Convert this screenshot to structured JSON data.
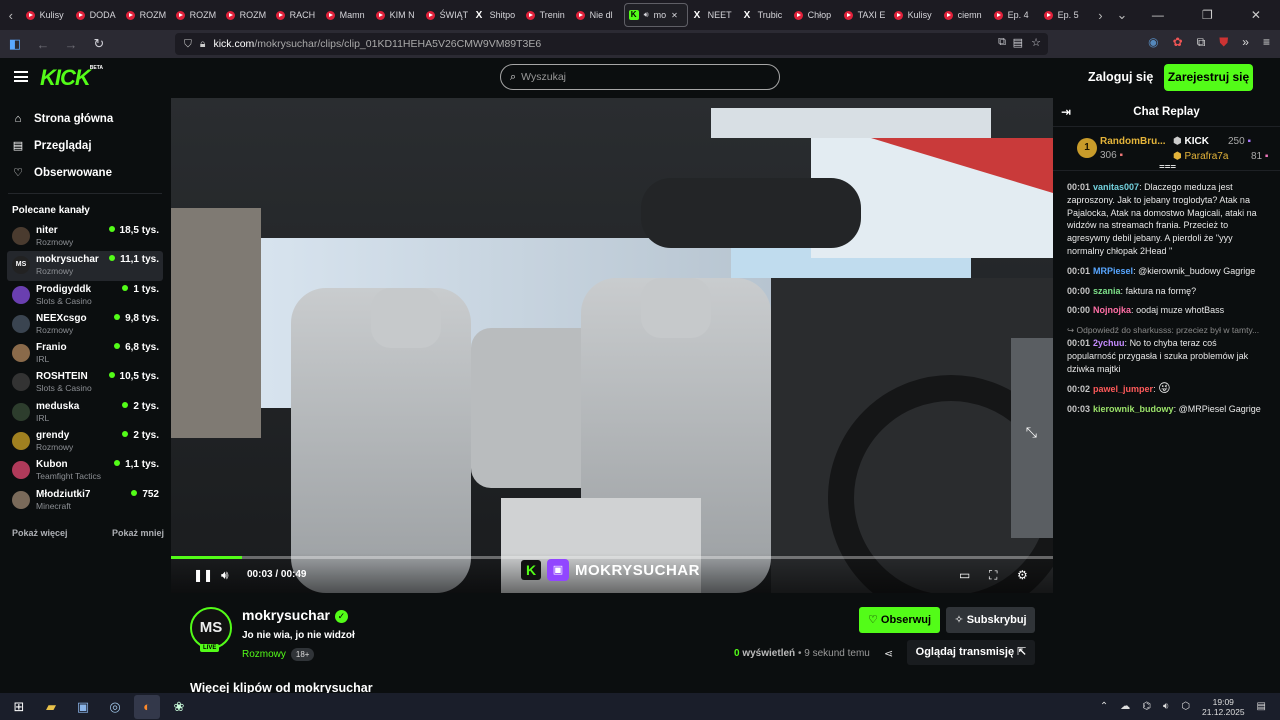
{
  "browser": {
    "tabs": [
      {
        "label": "Kulisy",
        "icon": "youtube"
      },
      {
        "label": "DODA",
        "icon": "youtube"
      },
      {
        "label": "ROZM",
        "icon": "youtube"
      },
      {
        "label": "ROZM",
        "icon": "youtube"
      },
      {
        "label": "ROZM",
        "icon": "youtube"
      },
      {
        "label": "RACH",
        "icon": "youtube"
      },
      {
        "label": "Mamn",
        "icon": "youtube"
      },
      {
        "label": "KIM N",
        "icon": "youtube"
      },
      {
        "label": "ŚWIĄT",
        "icon": "youtube"
      },
      {
        "label": "Shitpo",
        "icon": "x"
      },
      {
        "label": "Trenin",
        "icon": "youtube"
      },
      {
        "label": "Nie dl",
        "icon": "youtube"
      },
      {
        "label": "mo",
        "icon": "kick",
        "active": true
      },
      {
        "label": "NEET",
        "icon": "x"
      },
      {
        "label": "Trubic",
        "icon": "x"
      },
      {
        "label": "Chłop",
        "icon": "youtube"
      },
      {
        "label": "TAXI E",
        "icon": "youtube"
      },
      {
        "label": "Kulisy",
        "icon": "youtube"
      },
      {
        "label": "ciemn",
        "icon": "youtube"
      },
      {
        "label": "Ep. 4",
        "icon": "youtube"
      },
      {
        "label": "Ep. 5",
        "icon": "youtube"
      }
    ],
    "url_host": "kick.com",
    "url_path": "/mokrysuchar/clips/clip_01KD11HEHA5V26CMW9VM89T3E6"
  },
  "site": {
    "logo": "KICK",
    "logo_badge": "BETA",
    "search_placeholder": "Wyszukaj",
    "login_label": "Zaloguj się",
    "register_label": "Zarejestruj się"
  },
  "sidebar": {
    "nav": [
      {
        "label": "Strona główna",
        "icon": "home-icon"
      },
      {
        "label": "Przeglądaj",
        "icon": "browse-icon"
      },
      {
        "label": "Obserwowane",
        "icon": "heart-icon"
      }
    ],
    "recommended_title": "Polecane kanały",
    "channels": [
      {
        "name": "niter",
        "category": "Rozmowy",
        "viewers": "18,5 tys.",
        "color": "#4a3b2f"
      },
      {
        "name": "mokrysuchar",
        "category": "Rozmowy",
        "viewers": "11,1 tys.",
        "color": "#222",
        "selected": true
      },
      {
        "name": "Prodigyddk",
        "category": "Slots & Casino",
        "viewers": "1 tys.",
        "color": "#6a3fb0"
      },
      {
        "name": "NEEXcsgo",
        "category": "Rozmowy",
        "viewers": "9,8 tys.",
        "color": "#3a4450"
      },
      {
        "name": "Franio",
        "category": "IRL",
        "viewers": "6,8 tys.",
        "color": "#8a6a4a"
      },
      {
        "name": "ROSHTEIN",
        "category": "Slots & Casino",
        "viewers": "10,5 tys.",
        "color": "#333"
      },
      {
        "name": "meduska",
        "category": "IRL",
        "viewers": "2 tys.",
        "color": "#2d3d2d"
      },
      {
        "name": "grendy",
        "category": "Rozmowy",
        "viewers": "2 tys.",
        "color": "#a08020"
      },
      {
        "name": "Kubon",
        "category": "Teamfight Tactics",
        "viewers": "1,1 tys.",
        "color": "#b03a5a"
      },
      {
        "name": "Młodziutki7",
        "category": "Minecraft",
        "viewers": "752",
        "color": "#7a6a5a"
      }
    ],
    "show_more": "Pokaż więcej",
    "show_less": "Pokaż mniej"
  },
  "player": {
    "progress": 0.08,
    "time_current": "00:03",
    "time_sep": "/",
    "time_total": "00:49",
    "watermark": "MOKRYSUCHAR"
  },
  "chat": {
    "title": "Chat Replay",
    "pinned": [
      {
        "rank": "1",
        "name": "RandomBru...",
        "amount": "306"
      },
      {
        "name": "KICK",
        "amount": "250"
      },
      {
        "name": "Parafra7a",
        "amount": "81"
      }
    ],
    "messages": [
      {
        "time": "00:01",
        "user": "vanitas007",
        "color": "#73d2de",
        "text": "Dlaczego meduza jest zaproszony. Jak to jebany troglodyta? Atak na Pajalocka, Atak na domostwo Magicali, ataki na widzów na streamach frania. Przecież to agresywny debil jebany. A pierdoli że \"yyy normalny chłopak 2Head \""
      },
      {
        "time": "00:01",
        "user": "MRPiesel",
        "color": "#58a6ff",
        "text": "@kierownik_budowy Gagrige"
      },
      {
        "time": "00:00",
        "user": "szania",
        "color": "#7ee08a",
        "text": "faktura na formę?"
      },
      {
        "time": "00:00",
        "user": "Nojnojka",
        "color": "#ff6fa5",
        "text": "oodaj muze whotBass"
      },
      {
        "reply": "Odpowiedź do sharkusss: przeciez był w tamty...",
        "time": "00:01",
        "user": "2ychuu",
        "color": "#c58cff",
        "text": "No to chyba teraz coś popularność przygasła i szuka problemów jak dziwka majtki"
      },
      {
        "time": "00:02",
        "user": "pawel_jumper",
        "color": "#ff5a5a",
        "text": ""
      },
      {
        "time": "00:03",
        "user": "kierownik_budowy",
        "color": "#9be26a",
        "text": "@MRPiesel Gagrige"
      }
    ]
  },
  "channel": {
    "avatar_text": "MS",
    "live_label": "LIVE",
    "name": "mokrysuchar",
    "clip_title": "Jo nie wia, jo nie widzoł",
    "category": "Rozmowy",
    "age_badge": "18+",
    "follow_label": "Obserwuj",
    "subscribe_label": "Subskrybuj",
    "views_count": "0",
    "views_label": "wyświetleń",
    "dot": "•",
    "time_ago": "9 sekund temu",
    "watch_label": "Oglądaj transmisję",
    "more_clips": "Więcej klipów od mokrysuchar"
  },
  "taskbar": {
    "time": "19:09",
    "date": "21.12.2025"
  },
  "colors": {
    "accent": "#53fc18",
    "background": "#0b0e0f",
    "panel": "#24272c"
  }
}
